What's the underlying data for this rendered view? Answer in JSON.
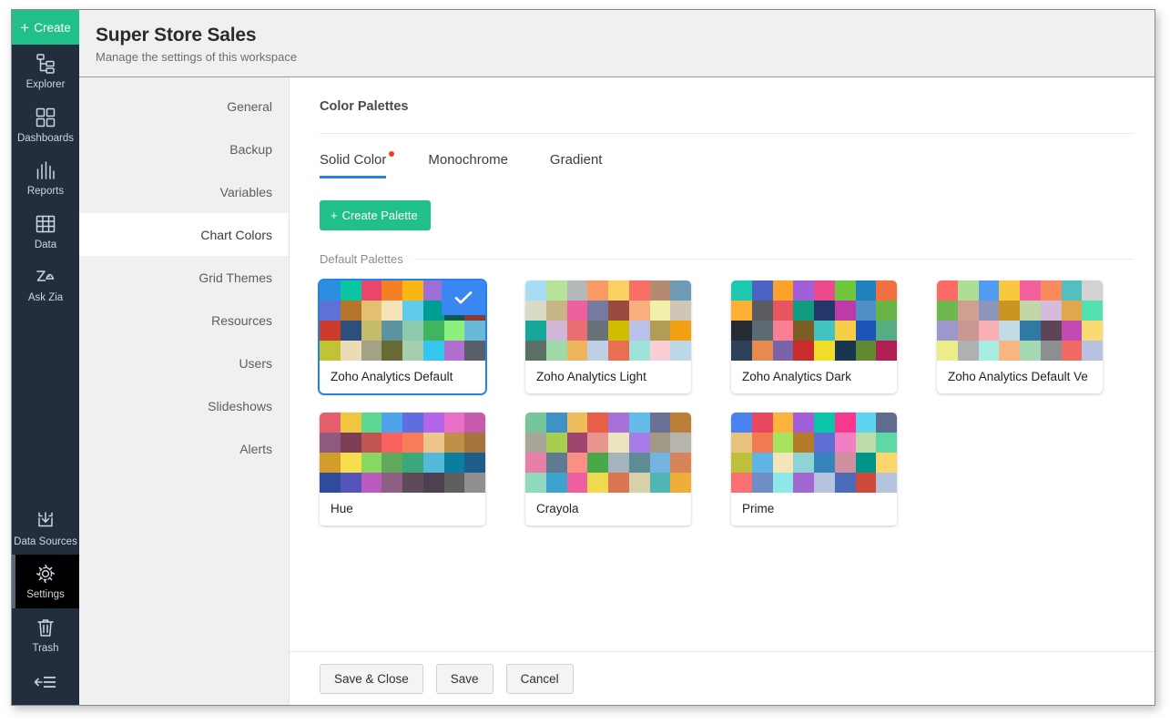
{
  "rail": {
    "create_label": "Create",
    "items": [
      {
        "label": "Explorer",
        "icon": "sitemap-icon",
        "active": false
      },
      {
        "label": "Dashboards",
        "icon": "dashboard-icon",
        "active": false
      },
      {
        "label": "Reports",
        "icon": "bar-chart-icon",
        "active": false
      },
      {
        "label": "Data",
        "icon": "table-icon",
        "active": false
      },
      {
        "label": "Ask Zia",
        "icon": "zia-icon",
        "active": false
      }
    ],
    "bottom_items": [
      {
        "label": "Data Sources",
        "icon": "data-sources-icon",
        "active": false
      },
      {
        "label": "Settings",
        "icon": "gear-icon",
        "active": true
      },
      {
        "label": "Trash",
        "icon": "trash-icon",
        "active": false
      }
    ],
    "collapse_icon": "collapse-sidebar-icon"
  },
  "header": {
    "title": "Super Store Sales",
    "subtitle": "Manage the settings of this workspace"
  },
  "settings_nav": {
    "items": [
      {
        "label": "General",
        "active": false
      },
      {
        "label": "Backup",
        "active": false
      },
      {
        "label": "Variables",
        "active": false
      },
      {
        "label": "Chart Colors",
        "active": true
      },
      {
        "label": "Grid Themes",
        "active": false
      },
      {
        "label": "Resources",
        "active": false
      },
      {
        "label": "Users",
        "active": false
      },
      {
        "label": "Slideshows",
        "active": false
      },
      {
        "label": "Alerts",
        "active": false
      }
    ]
  },
  "content": {
    "title": "Color Palettes",
    "tabs": [
      {
        "label": "Solid Color",
        "active": true,
        "badge": true
      },
      {
        "label": "Monochrome",
        "active": false,
        "badge": false
      },
      {
        "label": "Gradient",
        "active": false,
        "badge": false
      }
    ],
    "create_palette_label": "Create Palette",
    "create_palette_plus": "+",
    "section_label": "Default Palettes",
    "selected_check_icon": "check-icon",
    "accent_color": "#2680eb",
    "brand_green": "#21c08b",
    "badge_color": "#f03e21",
    "palettes": [
      {
        "name": "Zoho Analytics Default",
        "selected": true,
        "colors": [
          "#2a8fe0",
          "#0ac6a0",
          "#e8466a",
          "#f28024",
          "#fcb614",
          "#9b6fd6",
          "#00b8dd",
          "#3a87f2",
          "#5f71d6",
          "#b5762b",
          "#e3c070",
          "#f4e3b8",
          "#5ecbeb",
          "#009d94",
          "#0c5c4d",
          "#8a3a34",
          "#cc3b2b",
          "#2e4f7c",
          "#c4bb6b",
          "#5b93a0",
          "#8ecbae",
          "#41b55e",
          "#8cf07e",
          "#6ab9d8",
          "#c0c334",
          "#ecdcb5",
          "#a4a284",
          "#6a6a35",
          "#a4cfae",
          "#34c5f0",
          "#b06fce",
          "#5a6068"
        ]
      },
      {
        "name": "Zoho Analytics Light",
        "selected": false,
        "colors": [
          "#a8dcf5",
          "#b6e39a",
          "#b5b8ba",
          "#f79a63",
          "#fbd062",
          "#fa6f63",
          "#b58a72",
          "#6e9bb5",
          "#d9dbc8",
          "#c7b487",
          "#ee5f9f",
          "#757a9e",
          "#9b4a40",
          "#f9af7d",
          "#f1efac",
          "#cfc6b8",
          "#16a79a",
          "#cfb5d6",
          "#ea6d70",
          "#687278",
          "#cfbe00",
          "#b9c1ea",
          "#b39c54",
          "#f0a010",
          "#5c6f64",
          "#9ed9a7",
          "#eeb45c",
          "#bcd1e3",
          "#ea6f52",
          "#9ee2da",
          "#f9cfd5",
          "#bcd7e5"
        ]
      },
      {
        "name": "Zoho Analytics Dark",
        "selected": false,
        "colors": [
          "#1dc9b0",
          "#4c63c4",
          "#fba329",
          "#a35fd8",
          "#ec4a8e",
          "#6dc63b",
          "#1f82bd",
          "#f2703f",
          "#fcb034",
          "#5b5c61",
          "#e9555e",
          "#0f9b80",
          "#23376b",
          "#bd3aa8",
          "#4e90c6",
          "#69b446",
          "#262a33",
          "#5c6a74",
          "#f97f92",
          "#7c5d24",
          "#43c2c2",
          "#f6cf46",
          "#1b56b7",
          "#57ad83",
          "#2d4258",
          "#e78a50",
          "#7a63ab",
          "#c92c2c",
          "#f1dd28",
          "#16374e",
          "#618a33",
          "#b21f53"
        ]
      },
      {
        "name": "Zoho Analytics Default Ve",
        "selected": false,
        "colors": [
          "#fa6c66",
          "#aede93",
          "#4f9cf0",
          "#fbc741",
          "#f45f9d",
          "#fa8b5f",
          "#53bfbf",
          "#d0d2d4",
          "#6fb84f",
          "#cda08f",
          "#8d95bb",
          "#c99520",
          "#c3d6a8",
          "#d7bbda",
          "#e0a84e",
          "#55e0b2",
          "#9d98cb",
          "#c89891",
          "#f9afb6",
          "#c2dae3",
          "#2f79a7",
          "#5d4456",
          "#c44ab3",
          "#fbd973",
          "#ecec8a",
          "#b0b1b2",
          "#a9ece2",
          "#f7b582",
          "#a4d8b3",
          "#8e8e90",
          "#f16b64",
          "#b6c2de"
        ]
      },
      {
        "name": "Hue",
        "selected": false,
        "colors": [
          "#e55f6e",
          "#efc63f",
          "#5bd894",
          "#4fa2ec",
          "#5f6de0",
          "#b364e8",
          "#ea6fc6",
          "#c65bae",
          "#8e5a80",
          "#7c3e52",
          "#c25551",
          "#fa6161",
          "#fa7b58",
          "#ecc68a",
          "#bf8f47",
          "#a4733e",
          "#d29d28",
          "#fadd4c",
          "#87d861",
          "#5fa85c",
          "#3aa87c",
          "#54b8d8",
          "#0a7e9e",
          "#1e5c8c",
          "#2e4c9e",
          "#5355bb",
          "#bb5bbf",
          "#8e5f82",
          "#5e4a58",
          "#4e3f52",
          "#5f5f5f",
          "#8f8f8f"
        ]
      },
      {
        "name": "Crayola",
        "selected": false,
        "colors": [
          "#76c69d",
          "#3e92c6",
          "#efbc5c",
          "#e8604a",
          "#a472d9",
          "#63bce8",
          "#6b7194",
          "#bc7f3a",
          "#a9a59a",
          "#a6cf4f",
          "#9e4670",
          "#e8948f",
          "#ece4bd",
          "#a57ce8",
          "#a09a85",
          "#b8b5ae",
          "#e87fa6",
          "#5f7b91",
          "#fa8f85",
          "#4aa84a",
          "#a3b4bd",
          "#5f8b92",
          "#74b4df",
          "#d8845a",
          "#8fd9bc",
          "#3ea2cf",
          "#ee5fa0",
          "#f0d84f",
          "#d97553",
          "#d7d0a9",
          "#52b5b5",
          "#efae3a"
        ]
      },
      {
        "name": "Prime",
        "selected": false,
        "colors": [
          "#4a82f0",
          "#e8485f",
          "#fbb33e",
          "#a35fd8",
          "#0ac6a8",
          "#f6398c",
          "#5fd4ef",
          "#5f6b8f",
          "#e8c37e",
          "#f27a52",
          "#a6e35f",
          "#b57b28",
          "#5f6fd4",
          "#f07fc4",
          "#bddba8",
          "#5fd8a8",
          "#bdc03a",
          "#5fb4e3",
          "#f3e5b8",
          "#8fd4d4",
          "#3585bc",
          "#cf8f9e",
          "#00948a",
          "#fbd66c",
          "#fa7070",
          "#6f8ec6",
          "#8fe8e8",
          "#a368cf",
          "#b5c3df",
          "#4a6bb5",
          "#cf4a3a",
          "#b5c3df"
        ]
      }
    ]
  },
  "footer": {
    "buttons": [
      {
        "label": "Save & Close"
      },
      {
        "label": "Save"
      },
      {
        "label": "Cancel"
      }
    ]
  }
}
